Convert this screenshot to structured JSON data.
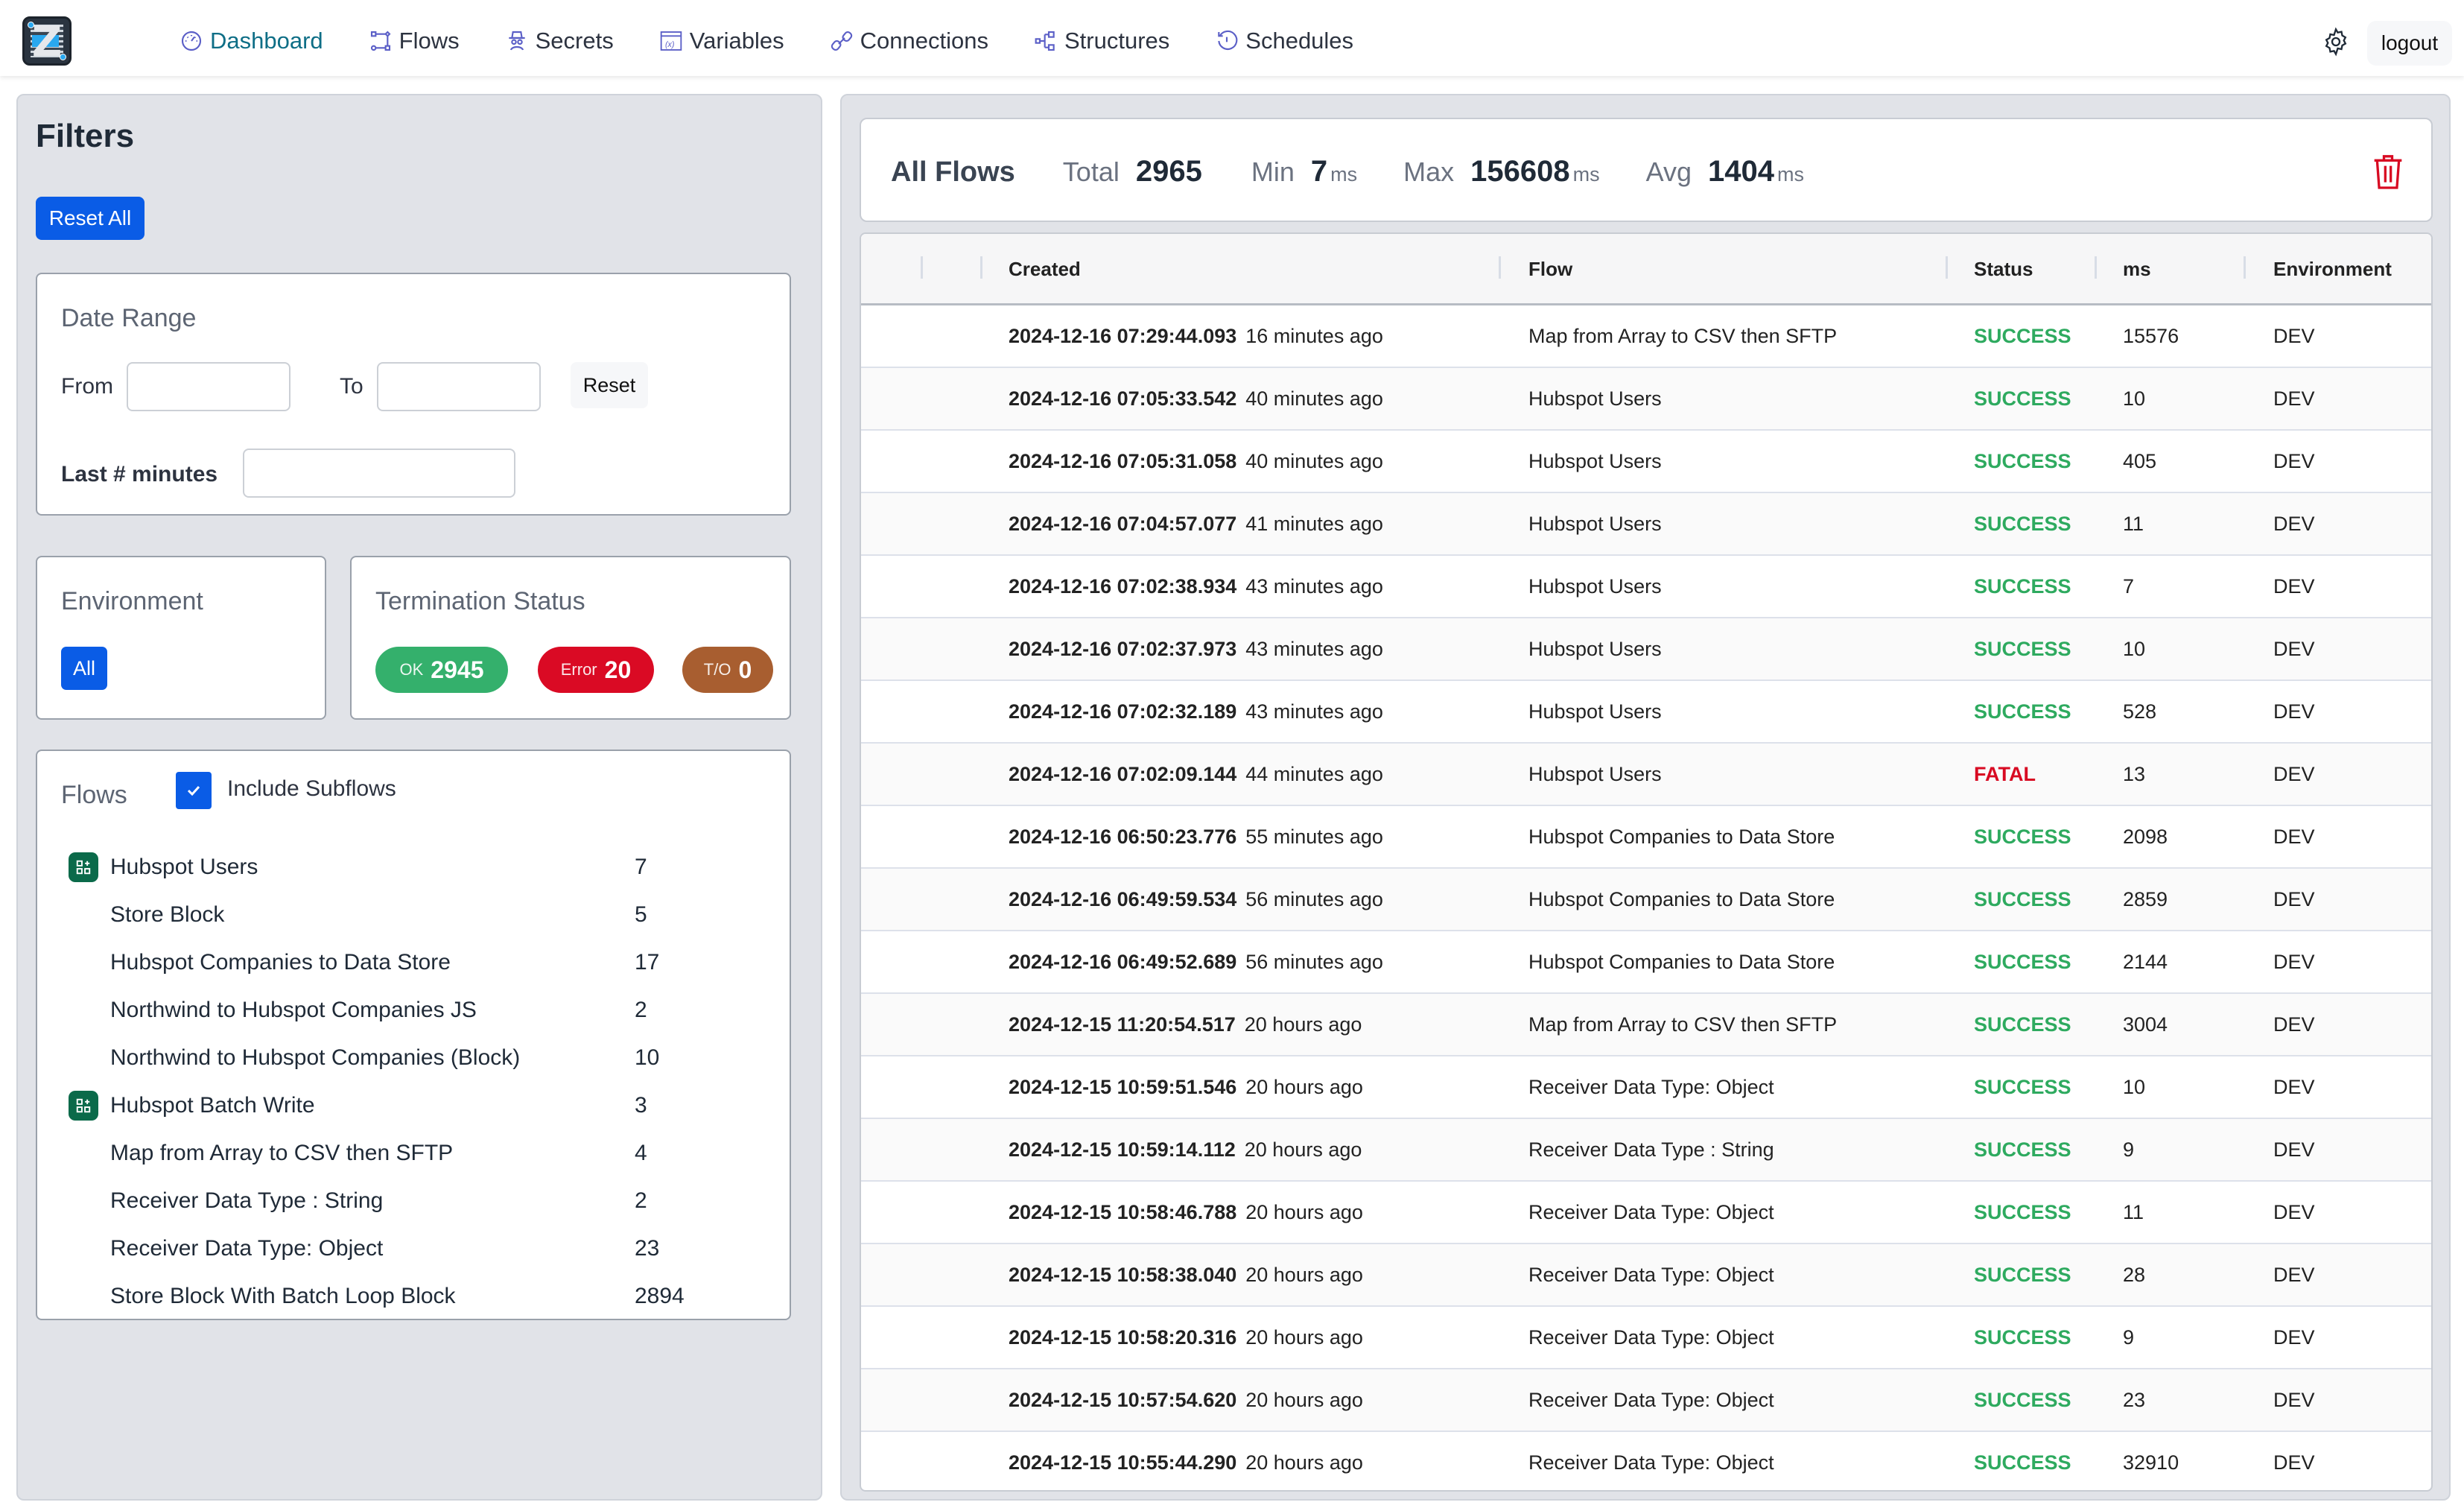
{
  "nav": {
    "items": [
      {
        "label": "Dashboard",
        "icon": "dashboard-gauge-icon",
        "active": true
      },
      {
        "label": "Flows",
        "icon": "flows-nodes-icon",
        "active": false
      },
      {
        "label": "Secrets",
        "icon": "secrets-spy-icon",
        "active": false
      },
      {
        "label": "Variables",
        "icon": "variables-x-icon",
        "active": false
      },
      {
        "label": "Connections",
        "icon": "connections-link-icon",
        "active": false
      },
      {
        "label": "Structures",
        "icon": "structures-tree-icon",
        "active": false
      },
      {
        "label": "Schedules",
        "icon": "schedules-clock-icon",
        "active": false
      }
    ],
    "settings_icon": "gear-icon",
    "logout_label": "logout"
  },
  "filters": {
    "title": "Filters",
    "reset_all_label": "Reset All",
    "date_range": {
      "title": "Date Range",
      "from_label": "From",
      "from_value": "",
      "to_label": "To",
      "to_value": "",
      "reset_label": "Reset",
      "last_minutes_label": "Last # minutes",
      "last_minutes_value": ""
    },
    "environment": {
      "title": "Environment",
      "selected": "All"
    },
    "termination_status": {
      "title": "Termination Status",
      "ok": {
        "label": "OK",
        "count": "2945",
        "color": "#34b06c"
      },
      "error": {
        "label": "Error",
        "count": "20",
        "color": "#da0a24"
      },
      "timeout": {
        "label": "T/O",
        "count": "0",
        "color": "#a85e30"
      }
    },
    "flows": {
      "title": "Flows",
      "include_subflows_label": "Include Subflows",
      "include_subflows_checked": true,
      "items": [
        {
          "name": "Hubspot Users",
          "count": "7",
          "has_icon": true
        },
        {
          "name": "Store Block",
          "count": "5",
          "has_icon": false
        },
        {
          "name": "Hubspot Companies to Data Store",
          "count": "17",
          "has_icon": false
        },
        {
          "name": "Northwind to Hubspot Companies JS",
          "count": "2",
          "has_icon": false
        },
        {
          "name": "Northwind to Hubspot Companies (Block)",
          "count": "10",
          "has_icon": false
        },
        {
          "name": "Hubspot Batch Write",
          "count": "3",
          "has_icon": true
        },
        {
          "name": "Map from Array to CSV then SFTP",
          "count": "4",
          "has_icon": false
        },
        {
          "name": "Receiver Data Type : String",
          "count": "2",
          "has_icon": false
        },
        {
          "name": "Receiver Data Type: Object",
          "count": "23",
          "has_icon": false
        },
        {
          "name": "Store Block With Batch Loop Block",
          "count": "2894",
          "has_icon": false
        }
      ]
    }
  },
  "stats": {
    "title": "All Flows",
    "total_label": "Total",
    "total_value": "2965",
    "min_label": "Min",
    "min_value": "7",
    "min_unit": "ms",
    "max_label": "Max",
    "max_value": "156608",
    "max_unit": "ms",
    "avg_label": "Avg",
    "avg_value": "1404",
    "avg_unit": "ms",
    "delete_icon": "trash-icon"
  },
  "table": {
    "columns": [
      "",
      "",
      "Created",
      "Flow",
      "Status",
      "ms",
      "Environment"
    ],
    "status_colors": {
      "SUCCESS": "#2eaa5f",
      "FATAL": "#d80a22"
    },
    "rows": [
      {
        "created": "2024-12-16 07:29:44.093",
        "ago": "16 minutes ago",
        "flow": "Map from Array to CSV then SFTP",
        "status": "SUCCESS",
        "ms": "15576",
        "env": "DEV"
      },
      {
        "created": "2024-12-16 07:05:33.542",
        "ago": "40 minutes ago",
        "flow": "Hubspot Users",
        "status": "SUCCESS",
        "ms": "10",
        "env": "DEV"
      },
      {
        "created": "2024-12-16 07:05:31.058",
        "ago": "40 minutes ago",
        "flow": "Hubspot Users",
        "status": "SUCCESS",
        "ms": "405",
        "env": "DEV"
      },
      {
        "created": "2024-12-16 07:04:57.077",
        "ago": "41 minutes ago",
        "flow": "Hubspot Users",
        "status": "SUCCESS",
        "ms": "11",
        "env": "DEV"
      },
      {
        "created": "2024-12-16 07:02:38.934",
        "ago": "43 minutes ago",
        "flow": "Hubspot Users",
        "status": "SUCCESS",
        "ms": "7",
        "env": "DEV"
      },
      {
        "created": "2024-12-16 07:02:37.973",
        "ago": "43 minutes ago",
        "flow": "Hubspot Users",
        "status": "SUCCESS",
        "ms": "10",
        "env": "DEV"
      },
      {
        "created": "2024-12-16 07:02:32.189",
        "ago": "43 minutes ago",
        "flow": "Hubspot Users",
        "status": "SUCCESS",
        "ms": "528",
        "env": "DEV"
      },
      {
        "created": "2024-12-16 07:02:09.144",
        "ago": "44 minutes ago",
        "flow": "Hubspot Users",
        "status": "FATAL",
        "ms": "13",
        "env": "DEV"
      },
      {
        "created": "2024-12-16 06:50:23.776",
        "ago": "55 minutes ago",
        "flow": "Hubspot Companies to Data Store",
        "status": "SUCCESS",
        "ms": "2098",
        "env": "DEV"
      },
      {
        "created": "2024-12-16 06:49:59.534",
        "ago": "56 minutes ago",
        "flow": "Hubspot Companies to Data Store",
        "status": "SUCCESS",
        "ms": "2859",
        "env": "DEV"
      },
      {
        "created": "2024-12-16 06:49:52.689",
        "ago": "56 minutes ago",
        "flow": "Hubspot Companies to Data Store",
        "status": "SUCCESS",
        "ms": "2144",
        "env": "DEV"
      },
      {
        "created": "2024-12-15 11:20:54.517",
        "ago": "20 hours ago",
        "flow": "Map from Array to CSV then SFTP",
        "status": "SUCCESS",
        "ms": "3004",
        "env": "DEV"
      },
      {
        "created": "2024-12-15 10:59:51.546",
        "ago": "20 hours ago",
        "flow": "Receiver Data Type: Object",
        "status": "SUCCESS",
        "ms": "10",
        "env": "DEV"
      },
      {
        "created": "2024-12-15 10:59:14.112",
        "ago": "20 hours ago",
        "flow": "Receiver Data Type : String",
        "status": "SUCCESS",
        "ms": "9",
        "env": "DEV"
      },
      {
        "created": "2024-12-15 10:58:46.788",
        "ago": "20 hours ago",
        "flow": "Receiver Data Type: Object",
        "status": "SUCCESS",
        "ms": "11",
        "env": "DEV"
      },
      {
        "created": "2024-12-15 10:58:38.040",
        "ago": "20 hours ago",
        "flow": "Receiver Data Type: Object",
        "status": "SUCCESS",
        "ms": "28",
        "env": "DEV"
      },
      {
        "created": "2024-12-15 10:58:20.316",
        "ago": "20 hours ago",
        "flow": "Receiver Data Type: Object",
        "status": "SUCCESS",
        "ms": "9",
        "env": "DEV"
      },
      {
        "created": "2024-12-15 10:57:54.620",
        "ago": "20 hours ago",
        "flow": "Receiver Data Type: Object",
        "status": "SUCCESS",
        "ms": "23",
        "env": "DEV"
      },
      {
        "created": "2024-12-15 10:55:44.290",
        "ago": "20 hours ago",
        "flow": "Receiver Data Type: Object",
        "status": "SUCCESS",
        "ms": "32910",
        "env": "DEV"
      }
    ]
  }
}
